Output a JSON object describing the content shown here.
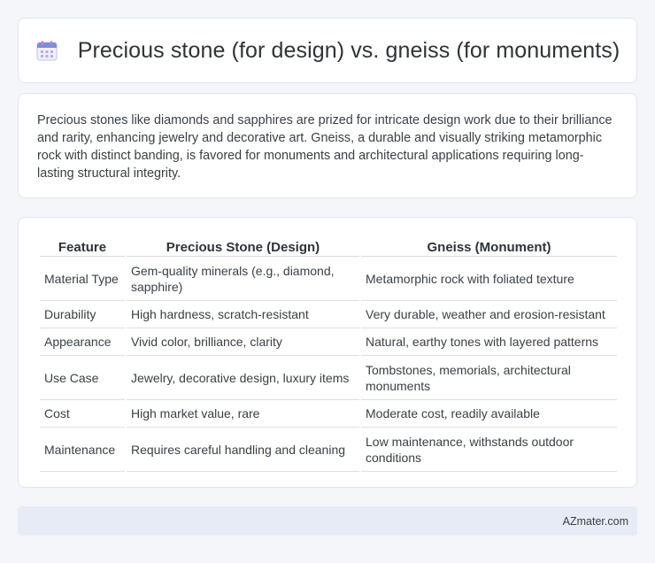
{
  "header": {
    "title": "Precious stone (for design) vs. gneiss (for monuments)",
    "icon": "calendar-icon",
    "icon_color": "#7b8fe0",
    "icon_accent": "#e27ba4"
  },
  "description": "Precious stones like diamonds and sapphires are prized for intricate design work due to their brilliance and rarity, enhancing jewelry and decorative art. Gneiss, a durable and visually striking metamorphic rock with distinct banding, is favored for monuments and architectural applications requiring long-lasting structural integrity.",
  "table": {
    "headers": [
      "Feature",
      "Precious Stone (Design)",
      "Gneiss (Monument)"
    ],
    "rows": [
      [
        "Material Type",
        "Gem-quality minerals (e.g., diamond, sapphire)",
        "Metamorphic rock with foliated texture"
      ],
      [
        "Durability",
        "High hardness, scratch-resistant",
        "Very durable, weather and erosion-resistant"
      ],
      [
        "Appearance",
        "Vivid color, brilliance, clarity",
        "Natural, earthy tones with layered patterns"
      ],
      [
        "Use Case",
        "Jewelry, decorative design, luxury items",
        "Tombstones, memorials, architectural monuments"
      ],
      [
        "Cost",
        "High market value, rare",
        "Moderate cost, readily available"
      ],
      [
        "Maintenance",
        "Requires careful handling and cleaning",
        "Low maintenance, withstands outdoor conditions"
      ]
    ]
  },
  "footer": {
    "text": "AZmater.com"
  }
}
